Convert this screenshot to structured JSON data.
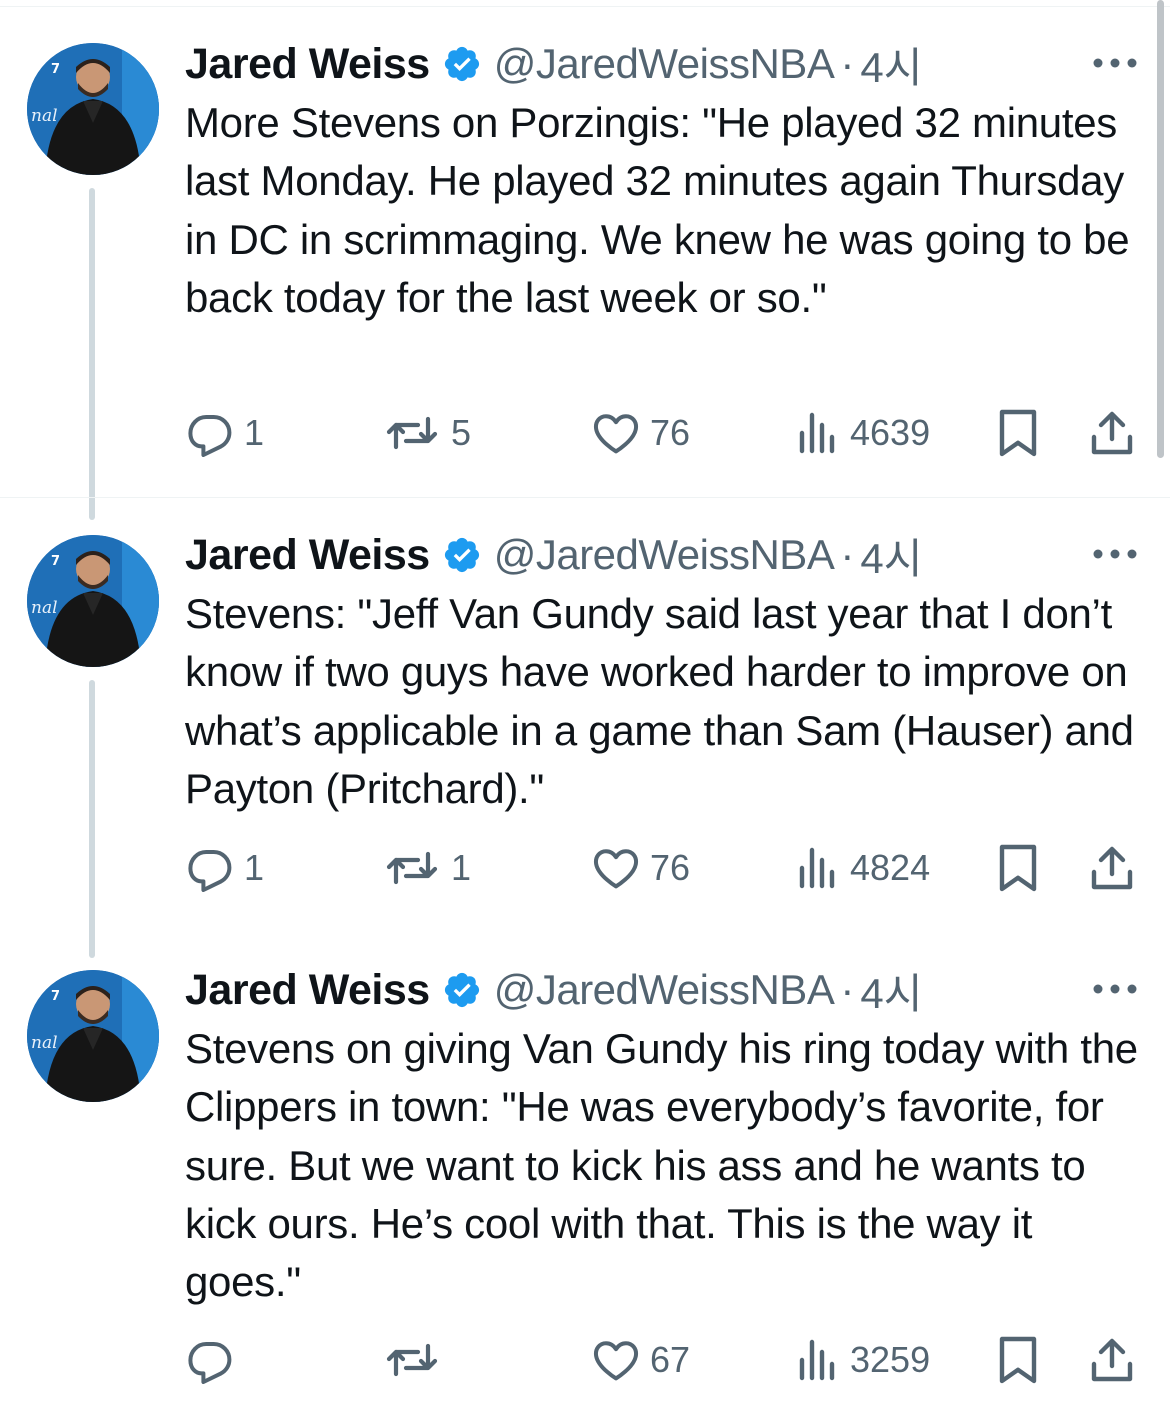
{
  "tweets": [
    {
      "name": "Jared Weiss",
      "handle": "@JaredWeissNBA",
      "separator": "·",
      "time": "4시",
      "text": "More Stevens on Porzingis: \"He played 32 minutes last Monday. He played 32 minutes again Thursday in DC in scrimmaging. We knew he was going to be back today for the last week or so.\"",
      "replies": "1",
      "reposts": "5",
      "likes": "76",
      "views": "4639"
    },
    {
      "name": "Jared Weiss",
      "handle": "@JaredWeissNBA",
      "separator": "·",
      "time": "4시",
      "text": "Stevens: \"Jeff Van Gundy said last year that I don’t know if two guys have worked harder to improve on what’s applicable in a game than Sam (Hauser) and Payton (Pritchard).\"",
      "replies": "1",
      "reposts": "1",
      "likes": "76",
      "views": "4824"
    },
    {
      "name": "Jared Weiss",
      "handle": "@JaredWeissNBA",
      "separator": "·",
      "time": "4시",
      "text": "Stevens on giving Van Gundy his ring today with the Clippers in town: \"He was everybody’s favorite, for sure. But we want to kick his ass and he wants to kick ours. He’s cool with that. This is the way it goes.\"",
      "replies": "",
      "reposts": "",
      "likes": "67",
      "views": "3259"
    }
  ],
  "colors": {
    "text": "#0f1419",
    "secondary": "#536471",
    "verified": "#1d9bf0",
    "thread_line": "#cfd9de",
    "divider": "#eff3f4"
  },
  "icons": [
    "reply-icon",
    "repost-icon",
    "like-icon",
    "views-icon",
    "bookmark-icon",
    "share-icon",
    "more-icon",
    "verified-badge-icon"
  ]
}
